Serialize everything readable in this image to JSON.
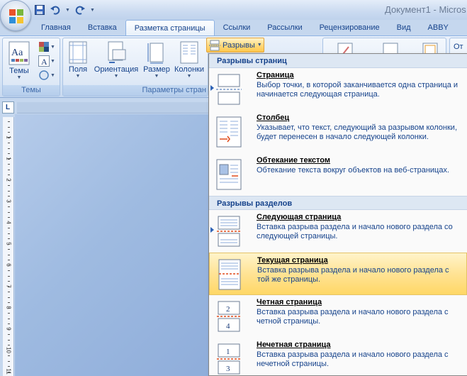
{
  "window": {
    "title": "Документ1 - Micros"
  },
  "tabs": [
    {
      "label": "Главная",
      "active": false
    },
    {
      "label": "Вставка",
      "active": false
    },
    {
      "label": "Разметка страницы",
      "active": true
    },
    {
      "label": "Ссылки",
      "active": false
    },
    {
      "label": "Рассылки",
      "active": false
    },
    {
      "label": "Рецензирование",
      "active": false
    },
    {
      "label": "Вид",
      "active": false
    },
    {
      "label": "ABBY",
      "active": false
    }
  ],
  "ribbon": {
    "themes_group": {
      "label": "Темы",
      "themes_button": "Темы"
    },
    "page_setup_group": {
      "label": "Параметры стран",
      "buttons": [
        "Поля",
        "Ориентация",
        "Размер",
        "Колонки"
      ]
    },
    "breaks_button": "Разрывы",
    "right_text": "От"
  },
  "rulers": {
    "corner_glyph": "L",
    "vertical_numbers": [
      "1",
      "1",
      "2",
      "3",
      "4",
      "5",
      "6",
      "7",
      "8",
      "9",
      "10",
      "11"
    ]
  },
  "menu": {
    "sections": [
      {
        "header": "Разрывы страниц",
        "items": [
          {
            "title": "Страница",
            "description": "Выбор точки, в которой заканчивается одна страница и начинается следующая страница."
          },
          {
            "title": "Столбец",
            "description": "Указывает, что текст, следующий за разрывом колонки, будет перенесен в начало следующей колонки."
          },
          {
            "title": "Обтекание текстом",
            "description": "Обтекание текста вокруг объектов на веб-страницах."
          }
        ]
      },
      {
        "header": "Разрывы разделов",
        "items": [
          {
            "title": "Следующая страница",
            "description": "Вставка разрыва раздела и начало нового раздела со следующей страницы."
          },
          {
            "title": "Текущая страница",
            "description": "Вставка разрыва раздела и начало нового раздела с той же страницы."
          },
          {
            "title": "Четная страница",
            "description": "Вставка разрыва раздела и начало нового раздела с четной страницы.",
            "icon_numbers": [
              "2",
              "4"
            ]
          },
          {
            "title": "Нечетная страница",
            "description": "Вставка разрыва раздела и начало нового раздела с нечетной страницы.",
            "icon_numbers": [
              "1",
              "3"
            ]
          }
        ]
      }
    ]
  },
  "colors": {
    "accent_text": "#15428b",
    "highlight": "#ffe394",
    "break_marker": "#e04a1a",
    "ribbon_bg": "#dde8f6"
  }
}
